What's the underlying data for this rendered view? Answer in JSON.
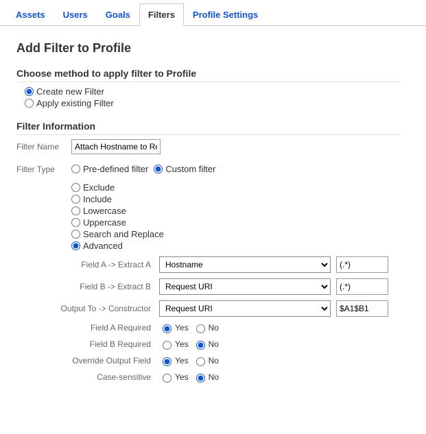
{
  "tabs": {
    "items": [
      {
        "label": "Assets"
      },
      {
        "label": "Users"
      },
      {
        "label": "Goals"
      },
      {
        "label": "Filters"
      },
      {
        "label": "Profile Settings"
      }
    ],
    "active_index": 3
  },
  "page_title": "Add Filter to Profile",
  "method_section": {
    "title": "Choose method to apply filter to Profile",
    "options": {
      "create": "Create new Filter",
      "apply": "Apply existing Filter"
    },
    "selected": "create"
  },
  "filter_info": {
    "title": "Filter Information",
    "name_label": "Filter Name",
    "name_value": "Attach Hostname to Re",
    "type_label": "Filter Type",
    "type_options": {
      "predefined": "Pre-defined filter",
      "custom": "Custom filter"
    },
    "type_selected": "custom",
    "subtypes": {
      "exclude": "Exclude",
      "include": "Include",
      "lowercase": "Lowercase",
      "uppercase": "Uppercase",
      "search_replace": "Search and Replace",
      "advanced": "Advanced"
    },
    "subtype_selected": "advanced"
  },
  "advanced": {
    "fieldA": {
      "label": "Field A -> Extract A",
      "select": "Hostname",
      "pattern": "(.*)"
    },
    "fieldB": {
      "label": "Field B -> Extract B",
      "select": "Request URI",
      "pattern": "(.*)"
    },
    "output": {
      "label": "Output To -> Constructor",
      "select": "Request URI",
      "value": "$A1$B1"
    },
    "fieldA_required": {
      "label": "Field A Required",
      "yes": "Yes",
      "no": "No",
      "selected": "yes"
    },
    "fieldB_required": {
      "label": "Field B Required",
      "yes": "Yes",
      "no": "No",
      "selected": "no"
    },
    "override": {
      "label": "Override Output Field",
      "yes": "Yes",
      "no": "No",
      "selected": "yes"
    },
    "case_sensitive": {
      "label": "Case-sensitive",
      "yes": "Yes",
      "no": "No",
      "selected": "no"
    }
  }
}
